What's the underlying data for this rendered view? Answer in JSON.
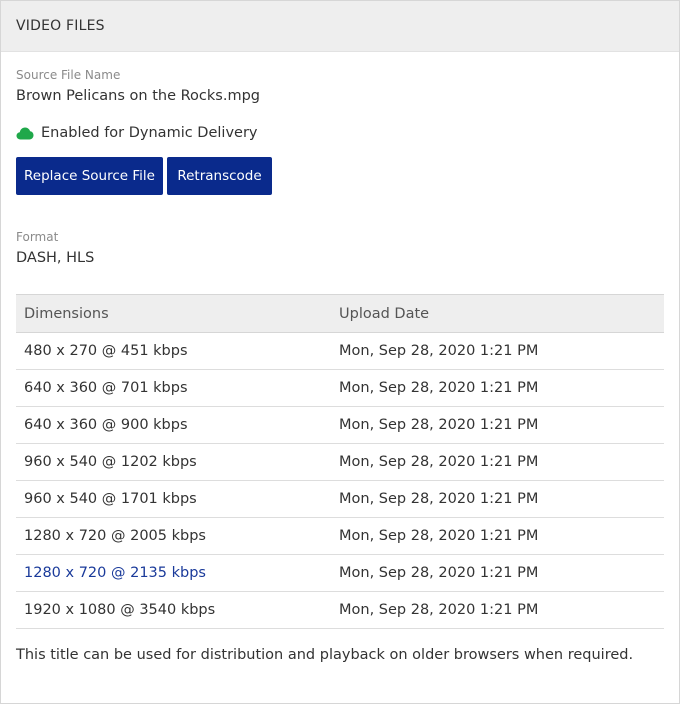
{
  "panel": {
    "title": "VIDEO FILES"
  },
  "source": {
    "label": "Source File Name",
    "value": "Brown Pelicans on the Rocks.mpg"
  },
  "delivery": {
    "icon": "cloud-icon",
    "status": "Enabled for Dynamic Delivery",
    "color": "#1fa84a"
  },
  "actions": {
    "replace_label": "Replace Source File",
    "retranscode_label": "Retranscode",
    "color": "#0a2a8c"
  },
  "format": {
    "label": "Format",
    "value": "DASH, HLS"
  },
  "table": {
    "headers": [
      "Dimensions",
      "Upload Date"
    ],
    "rows": [
      {
        "dimensions": "480 x 270 @ 451 kbps",
        "date": "Mon, Sep 28, 2020 1:21 PM"
      },
      {
        "dimensions": "640 x 360 @ 701 kbps",
        "date": "Mon, Sep 28, 2020 1:21 PM"
      },
      {
        "dimensions": "640 x 360 @ 900 kbps",
        "date": "Mon, Sep 28, 2020 1:21 PM"
      },
      {
        "dimensions": "960 x 540 @ 1202 kbps",
        "date": "Mon, Sep 28, 2020 1:21 PM"
      },
      {
        "dimensions": "960 x 540 @ 1701 kbps",
        "date": "Mon, Sep 28, 2020 1:21 PM"
      },
      {
        "dimensions": "1280 x 720 @ 2005 kbps",
        "date": "Mon, Sep 28, 2020 1:21 PM"
      },
      {
        "dimensions": "1280 x 720 @ 2135 kbps",
        "date": "Mon, Sep 28, 2020 1:21 PM"
      },
      {
        "dimensions": "1920 x 1080 @ 3540 kbps",
        "date": "Mon, Sep 28, 2020 1:21 PM"
      }
    ],
    "highlight_color": "#1a3a9a"
  },
  "footnote": "This title can be used for distribution and playback on older browsers when required."
}
